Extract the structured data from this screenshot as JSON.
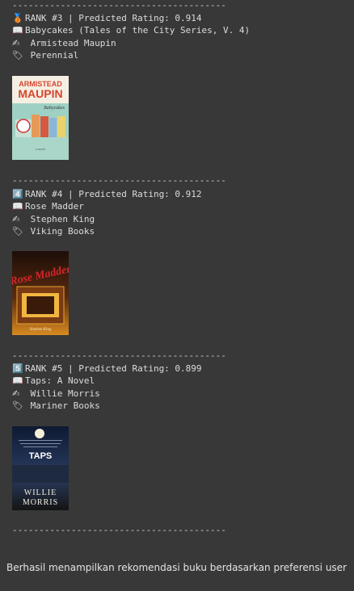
{
  "separator": "----------------------------------------",
  "books": [
    {
      "rank_icon": "🥉",
      "rank_line": "RANK #3 | Predicted Rating: 0.914",
      "title_icon": "📖",
      "title": "Babycakes (Tales of the City Series, V. 4)",
      "author_icon": "✍",
      "author": " Armistead Maupin",
      "publisher_icon": "🏷",
      "publisher": " Perennial",
      "cover_image": "Book cover: Babycakes by Armistead Maupin",
      "cover_lettering": [
        "ARMISTEAD",
        "MAUPIN",
        "Babycakes",
        "a novel"
      ]
    },
    {
      "rank_icon": "4️⃣",
      "rank_line": "RANK #4 | Predicted Rating: 0.912",
      "title_icon": "📖",
      "title": "Rose Madder",
      "author_icon": "✍",
      "author": " Stephen King",
      "publisher_icon": "🏷",
      "publisher": " Viking Books",
      "cover_image": "Book cover: Rose Madder by Stephen King",
      "cover_lettering": [
        "Rose Madder",
        "Stephen King"
      ]
    },
    {
      "rank_icon": "5️⃣",
      "rank_line": "RANK #5 | Predicted Rating: 0.899",
      "title_icon": "📖",
      "title": "Taps: A Novel",
      "author_icon": "✍",
      "author": " Willie Morris",
      "publisher_icon": "🏷",
      "publisher": " Mariner Books",
      "cover_image": "Book cover: Taps by Willie Morris",
      "cover_lettering": [
        "TAPS",
        "WILLIE",
        "MORRIS"
      ]
    }
  ],
  "footer_text": "Berhasil menampilkan rekomendasi buku berdasarkan preferensi user"
}
